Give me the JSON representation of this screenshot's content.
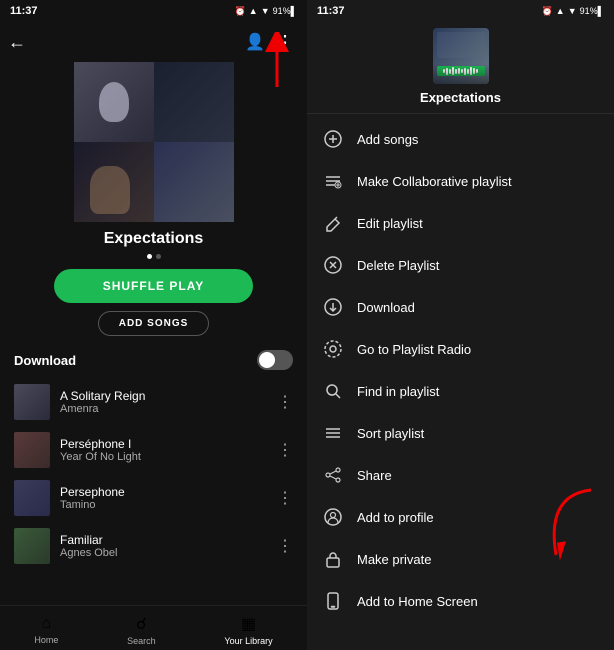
{
  "left": {
    "status_time": "11:37",
    "playlist_title": "Expectations",
    "shuffle_label": "SHUFFLE PLAY",
    "add_songs_label": "ADD SONGS",
    "download_label": "Download",
    "nav": [
      {
        "label": "Home",
        "icon": "⌂",
        "active": false
      },
      {
        "label": "Search",
        "icon": "⌕",
        "active": false
      },
      {
        "label": "Your Library",
        "icon": "⊞",
        "active": false
      }
    ],
    "tracks": [
      {
        "name": "A Solitary Reign",
        "artist": "Amenra",
        "art": "ta1"
      },
      {
        "name": "Perséphone I",
        "artist": "Year Of No Light",
        "art": "ta2"
      },
      {
        "name": "Persephone",
        "artist": "Tamino",
        "art": "ta3"
      },
      {
        "name": "Familiar",
        "artist": "Agnes Obel",
        "art": "ta4"
      },
      {
        "name": "...",
        "artist": "...",
        "art": "ta5"
      }
    ]
  },
  "right": {
    "status_time": "11:37",
    "playlist_name": "Expectations",
    "menu_items": [
      {
        "icon": "plus_circle",
        "label": "Add songs"
      },
      {
        "icon": "music_collab",
        "label": "Make Collaborative playlist"
      },
      {
        "icon": "pencil",
        "label": "Edit playlist"
      },
      {
        "icon": "x_circle",
        "label": "Delete Playlist"
      },
      {
        "icon": "download",
        "label": "Download"
      },
      {
        "icon": "radio",
        "label": "Go to Playlist Radio"
      },
      {
        "icon": "search",
        "label": "Find in playlist"
      },
      {
        "icon": "sort",
        "label": "Sort playlist"
      },
      {
        "icon": "share",
        "label": "Share"
      },
      {
        "icon": "person_circle",
        "label": "Add to profile"
      },
      {
        "icon": "lock",
        "label": "Make private"
      },
      {
        "icon": "phone",
        "label": "Add to Home Screen"
      }
    ]
  }
}
